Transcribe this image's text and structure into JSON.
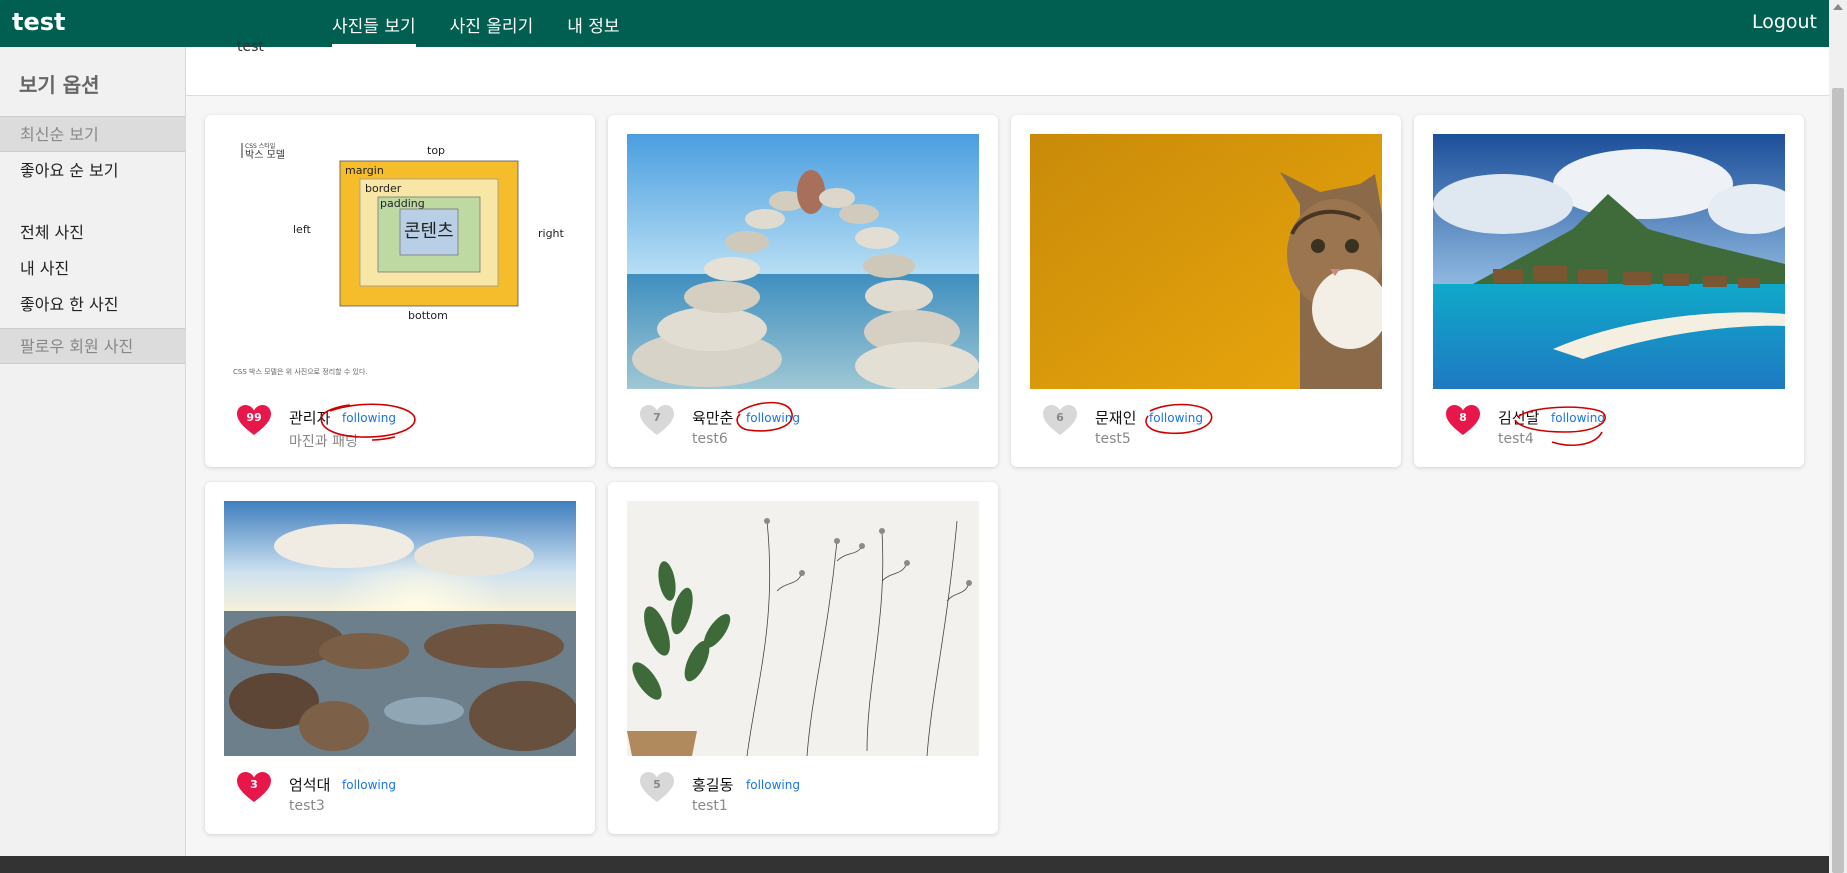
{
  "app": {
    "brand": "test",
    "logout": "Logout"
  },
  "nav": {
    "items": [
      {
        "label": "사진들 보기",
        "active": true
      },
      {
        "label": "사진 올리기"
      },
      {
        "label": "내 정보"
      }
    ]
  },
  "sidebar": {
    "title": "보기 옵션",
    "items": [
      {
        "label": "최신순 보기"
      },
      {
        "label": "좋아요 순 보기"
      },
      {
        "label": "전체 사진"
      },
      {
        "label": "내 사진"
      },
      {
        "label": "좋아요 한 사진"
      },
      {
        "label": "팔로우 회원 사진"
      }
    ]
  },
  "header": {
    "text": "test"
  },
  "follow_label": "following",
  "diagram": {
    "heading_small": "CSS 스타일",
    "heading": "박스 모델",
    "top": "top",
    "bottom": "bottom",
    "left": "left",
    "right": "right",
    "margin": "margin",
    "border": "border",
    "padding": "padding",
    "content": "콘텐츠",
    "caption": "CSS 박스 모델은 위 사진으로 정리할 수 있다."
  },
  "cards": [
    {
      "user": "관리자",
      "sub": "마진과 패딩",
      "likes": "99",
      "liked": true
    },
    {
      "user": "육만춘",
      "sub": "test6",
      "likes": "7",
      "liked": false
    },
    {
      "user": "문재인",
      "sub": "test5",
      "likes": "6",
      "liked": false
    },
    {
      "user": "김선달",
      "sub": "test4",
      "likes": "8",
      "liked": true
    },
    {
      "user": "엄석대",
      "sub": "test3",
      "likes": "3",
      "liked": true
    },
    {
      "user": "홍길동",
      "sub": "test1",
      "likes": "5",
      "liked": false
    }
  ],
  "colors": {
    "nav": "#005f50",
    "liked": "#e8174a",
    "unliked": "#d8d8d8",
    "follow": "#1a73e8",
    "annotation": "#d10000"
  }
}
